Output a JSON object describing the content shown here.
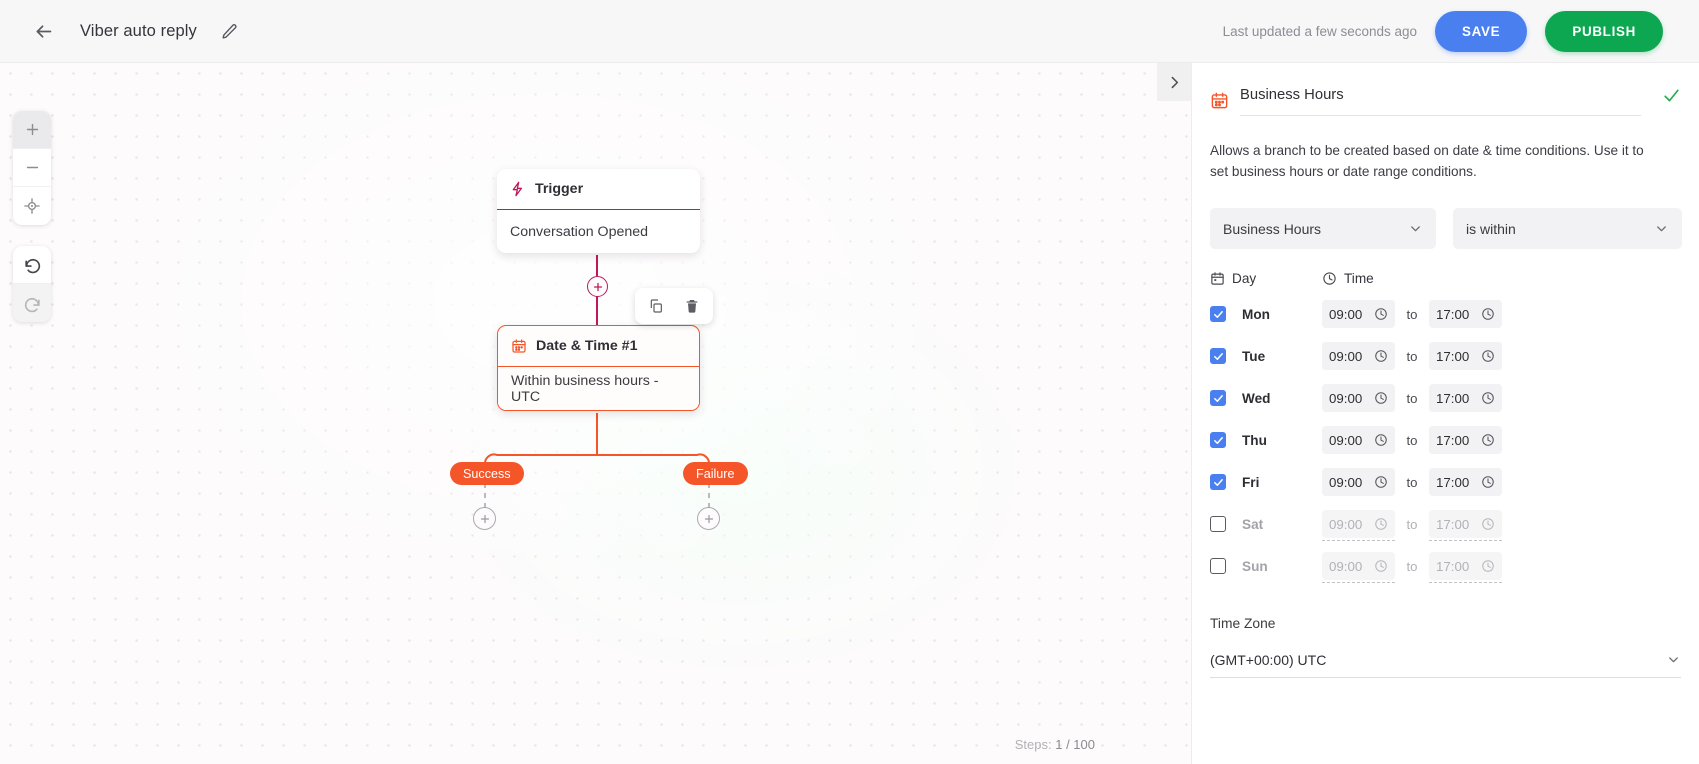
{
  "topbar": {
    "back_icon": "arrow-left-icon",
    "title": "Viber auto reply",
    "edit_icon": "pencil-icon",
    "last_updated": "Last updated a few seconds ago",
    "save_label": "SAVE",
    "publish_label": "PUBLISH",
    "save_color": "#4a7ff0",
    "publish_color": "#0ca750"
  },
  "canvas": {
    "zoom_tools": [
      {
        "name": "zoom-in-icon",
        "glyph": "+"
      },
      {
        "name": "zoom-out-icon",
        "glyph": "−"
      },
      {
        "name": "fit-to-screen-icon",
        "glyph": "⌖"
      }
    ],
    "history_tools": [
      {
        "name": "undo-icon"
      },
      {
        "name": "redo-icon"
      }
    ],
    "collapse_icon": "chevron-right-icon",
    "nodes": [
      {
        "id": "trigger",
        "icon": "lightning-icon",
        "title": "Trigger",
        "subtitle": "Conversation Opened",
        "accent": "#c2185b"
      },
      {
        "id": "datetime",
        "icon": "calendar-icon",
        "title": "Date & Time #1",
        "subtitle": "Within business hours - UTC",
        "accent": "#f4562a"
      }
    ],
    "node_actions": [
      {
        "name": "duplicate-node-icon"
      },
      {
        "name": "delete-node-icon"
      }
    ],
    "branches": [
      {
        "label": "Success",
        "color": "#f4562a"
      },
      {
        "label": "Failure",
        "color": "#f4562a"
      }
    ],
    "add_buttons": [
      {
        "name": "add-step-icon",
        "glyph": "+"
      },
      {
        "name": "add-step-success-icon",
        "glyph": "+"
      },
      {
        "name": "add-step-failure-icon",
        "glyph": "+"
      }
    ],
    "steps_prefix": "Steps:",
    "steps_value": "1 / 100"
  },
  "panel": {
    "icon": "calendar-icon",
    "title": "Business Hours",
    "valid_icon": "check-icon",
    "description": "Allows a branch to be created based on date & time conditions. Use it to set business hours or date range conditions.",
    "condition_select": {
      "value": "Business Hours",
      "chevron": "chevron-down-icon"
    },
    "operator_select": {
      "value": "is within",
      "chevron": "chevron-down-icon"
    },
    "table": {
      "day_header": "Day",
      "day_header_icon": "calendar-icon",
      "time_header": "Time",
      "time_header_icon": "clock-icon",
      "to_label": "to",
      "clock_icon": "clock-icon",
      "rows": [
        {
          "day": "Mon",
          "checked": true,
          "from": "09:00",
          "to": "17:00"
        },
        {
          "day": "Tue",
          "checked": true,
          "from": "09:00",
          "to": "17:00"
        },
        {
          "day": "Wed",
          "checked": true,
          "from": "09:00",
          "to": "17:00"
        },
        {
          "day": "Thu",
          "checked": true,
          "from": "09:00",
          "to": "17:00"
        },
        {
          "day": "Fri",
          "checked": true,
          "from": "09:00",
          "to": "17:00"
        },
        {
          "day": "Sat",
          "checked": false,
          "from": "09:00",
          "to": "17:00"
        },
        {
          "day": "Sun",
          "checked": false,
          "from": "09:00",
          "to": "17:00"
        }
      ]
    },
    "timezone_label": "Time Zone",
    "timezone_value": "(GMT+00:00) UTC",
    "timezone_chevron": "chevron-down-icon"
  }
}
